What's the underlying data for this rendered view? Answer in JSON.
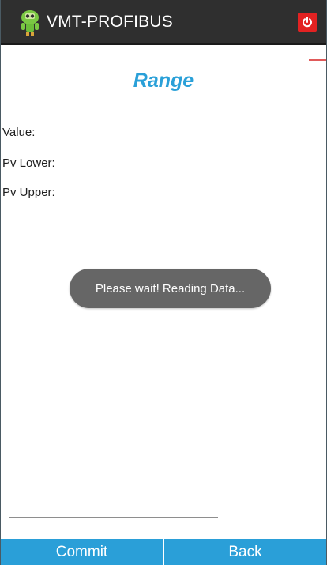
{
  "app_bar": {
    "title": "VMT-PROFIBUS",
    "logo_icon": "robot-logo-icon",
    "power_icon": "power-icon",
    "colors": {
      "background": "#2f2f2f",
      "power": "#e22222",
      "logo": "#7ac943"
    }
  },
  "page": {
    "title": "Range",
    "title_color": "#2aa0d8"
  },
  "fields": [
    {
      "label": "Value:"
    },
    {
      "label": "Pv Lower:"
    },
    {
      "label": "Pv Upper:"
    }
  ],
  "toast": {
    "message": "Please wait! Reading Data..."
  },
  "buttons": {
    "commit": "Commit",
    "back": "Back",
    "color": "#2a9fd8"
  }
}
